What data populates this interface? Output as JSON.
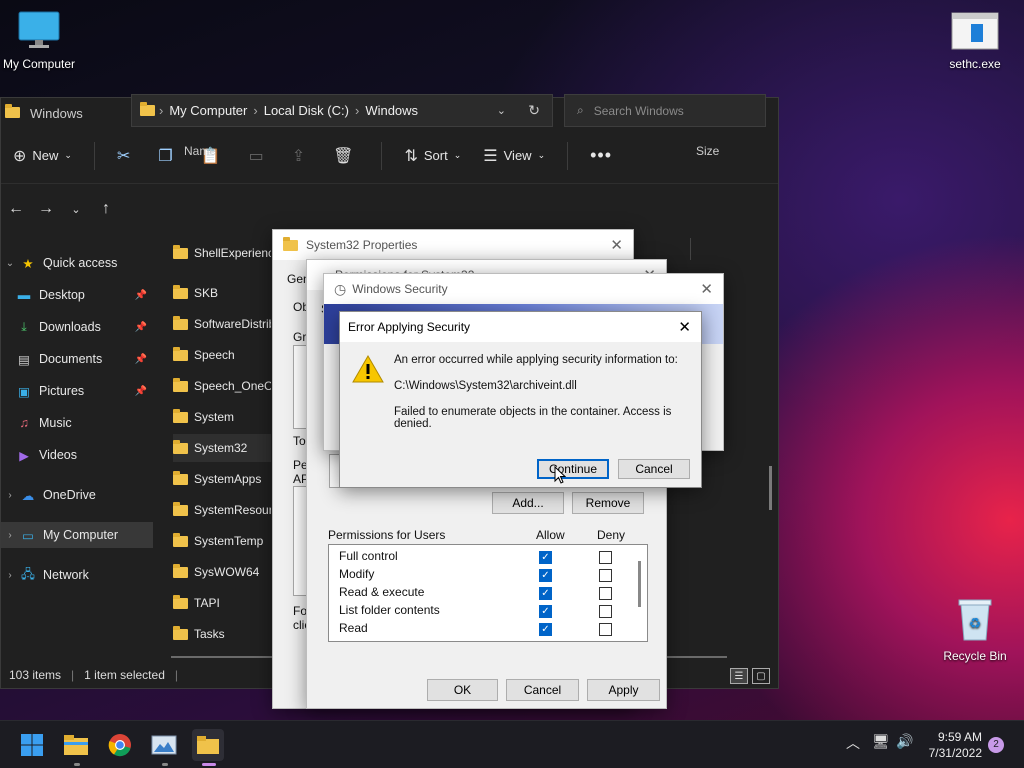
{
  "desktop": {
    "icons": [
      {
        "label": "My Computer"
      },
      {
        "label": "sethc.exe"
      },
      {
        "label": "Recycle Bin"
      }
    ]
  },
  "explorer": {
    "title": "Windows",
    "toolbar": {
      "new": "New",
      "sort": "Sort",
      "view": "View"
    },
    "address": {
      "parts": [
        "My Computer",
        "Local Disk (C:)",
        "Windows"
      ]
    },
    "search_placeholder": "Search Windows",
    "columns": {
      "name": "Name",
      "size": "Size"
    },
    "sidebar": [
      {
        "label": "Quick access"
      },
      {
        "label": "Desktop"
      },
      {
        "label": "Downloads"
      },
      {
        "label": "Documents"
      },
      {
        "label": "Pictures"
      },
      {
        "label": "Music"
      },
      {
        "label": "Videos"
      },
      {
        "label": "OneDrive"
      },
      {
        "label": "My Computer"
      },
      {
        "label": "Network"
      }
    ],
    "files": [
      "ShellExperiences",
      "SKB",
      "SoftwareDistribution",
      "Speech",
      "Speech_OneCore",
      "System",
      "System32",
      "SystemApps",
      "SystemResources",
      "SystemTemp",
      "SysWOW64",
      "TAPI",
      "Tasks"
    ],
    "status": {
      "items": "103 items",
      "selected": "1 item selected"
    }
  },
  "props": {
    "title": "System32 Properties",
    "tab_general": "Gen",
    "left_labels": [
      "Ob",
      "Gro",
      "To",
      "Pe",
      "AP",
      "For",
      "clic"
    ],
    "buttons": {
      "ok": "OK",
      "cancel": "Cancel",
      "apply": "Apply"
    }
  },
  "perms": {
    "title_partial": "Permissions for System32",
    "add": "Add...",
    "remove": "Remove",
    "header": "Permissions for Users",
    "allow": "Allow",
    "deny": "Deny",
    "rows": [
      {
        "name": "Full control"
      },
      {
        "name": "Modify"
      },
      {
        "name": "Read & execute"
      },
      {
        "name": "List folder contents"
      },
      {
        "name": "Read"
      }
    ]
  },
  "winsec": {
    "title": "Windows Security"
  },
  "error": {
    "title": "Error Applying Security",
    "line1": "An error occurred while applying security information to:",
    "path": "C:\\Windows\\System32\\archiveint.dll",
    "line2": "Failed to enumerate objects in the container. Access is denied.",
    "continue": "Continue",
    "cancel": "Cancel"
  },
  "taskbar": {
    "time": "9:59 AM",
    "date": "7/31/2022",
    "badge": "2"
  }
}
